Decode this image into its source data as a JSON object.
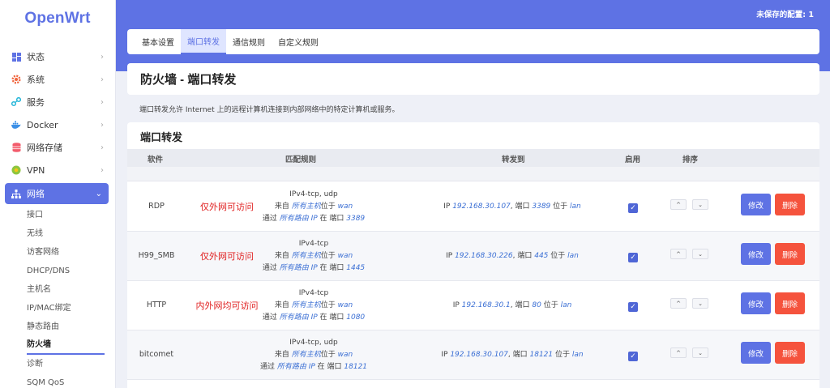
{
  "brand": "OpenWrt",
  "unsaved": "未保存的配置: 1",
  "sidebar": {
    "items": [
      {
        "label": "状态",
        "icon": "dashboard-icon"
      },
      {
        "label": "系统",
        "icon": "gear-icon"
      },
      {
        "label": "服务",
        "icon": "share-icon"
      },
      {
        "label": "Docker",
        "icon": "docker-icon"
      },
      {
        "label": "网络存储",
        "icon": "database-icon"
      },
      {
        "label": "VPN",
        "icon": "vpn-icon"
      },
      {
        "label": "网络",
        "icon": "network-icon"
      }
    ],
    "subitems": [
      "接口",
      "无线",
      "访客网络",
      "DHCP/DNS",
      "主机名",
      "IP/MAC绑定",
      "静态路由",
      "防火墙",
      "诊断",
      "SQM QoS"
    ]
  },
  "tabs": [
    "基本设置",
    "端口转发",
    "通信规则",
    "自定义规则"
  ],
  "page_title": "防火墙 - 端口转发",
  "description": "端口转发允许 Internet 上的远程计算机连接到内部网络中的特定计算机或服务。",
  "section_title": "端口转发",
  "table": {
    "headers": {
      "name": "软件",
      "match": "匹配规则",
      "forward": "转发到",
      "enable": "启用",
      "sort": "排序"
    },
    "rows": [
      {
        "name": "RDP",
        "note": "仅外网可访问",
        "proto": "IPv4-tcp, udp",
        "from_prefix": "来自 ",
        "from_host": "所有主机",
        "from_mid": "位于 ",
        "from_zone": "wan",
        "via_prefix": "通过 ",
        "via_ip": "所有路由 IP",
        "via_mid": " 在 端口 ",
        "via_port": "3389",
        "fwd_prefix": "IP ",
        "fwd_ip": "192.168.30.107",
        "fwd_mid": ", 端口 ",
        "fwd_port": "3389",
        "fwd_mid2": " 位于 ",
        "fwd_zone": "lan"
      },
      {
        "name": "H99_SMB",
        "note": "仅外网可访问",
        "proto": "IPv4-tcp",
        "from_prefix": "来自 ",
        "from_host": "所有主机",
        "from_mid": "位于 ",
        "from_zone": "wan",
        "via_prefix": "通过 ",
        "via_ip": "所有路由 IP",
        "via_mid": " 在 端口 ",
        "via_port": "1445",
        "fwd_prefix": "IP ",
        "fwd_ip": "192.168.30.226",
        "fwd_mid": ", 端口 ",
        "fwd_port": "445",
        "fwd_mid2": " 位于 ",
        "fwd_zone": "lan"
      },
      {
        "name": "HTTP",
        "note": "内外网均可访问",
        "proto": "IPv4-tcp",
        "from_prefix": "来自 ",
        "from_host": "所有主机",
        "from_mid": "位于 ",
        "from_zone": "wan",
        "via_prefix": "通过 ",
        "via_ip": "所有路由 IP",
        "via_mid": " 在 端口 ",
        "via_port": "1080",
        "fwd_prefix": "IP ",
        "fwd_ip": "192.168.30.1",
        "fwd_mid": ", 端口 ",
        "fwd_port": "80",
        "fwd_mid2": " 位于 ",
        "fwd_zone": "lan"
      },
      {
        "name": "bitcomet",
        "note": "",
        "proto": "IPv4-tcp, udp",
        "from_prefix": "来自 ",
        "from_host": "所有主机",
        "from_mid": "位于 ",
        "from_zone": "wan",
        "via_prefix": "通过 ",
        "via_ip": "所有路由 IP",
        "via_mid": " 在 端口 ",
        "via_port": "18121",
        "fwd_prefix": "IP ",
        "fwd_ip": "192.168.30.107",
        "fwd_mid": ", 端口 ",
        "fwd_port": "18121",
        "fwd_mid2": " 位于 ",
        "fwd_zone": "lan"
      }
    ],
    "edit_label": "修改",
    "delete_label": "删除",
    "up_glyph": "^",
    "down_glyph": "⌄"
  },
  "colors": {
    "accent": "#5e72e4",
    "danger": "#f5533d",
    "note": "#e02020"
  }
}
